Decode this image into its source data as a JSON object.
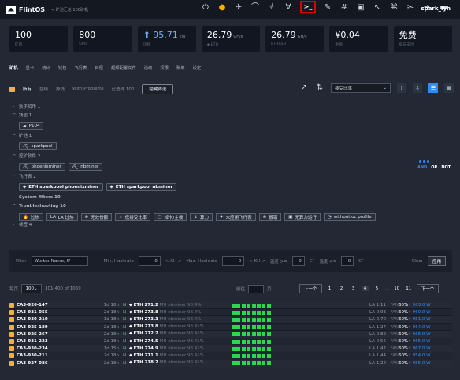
{
  "header": {
    "title": "FlintOS",
    "breadcrumb": "< 矿池汇总 100矿机",
    "user": "spark_lyh",
    "icons": [
      "power-icon",
      "warning-icon",
      "flash-icon",
      "graph-icon",
      "pipeline-icon",
      "filter-icon",
      "terminal-icon",
      "brush-icon",
      "hash-icon",
      "display-icon",
      "wrench-icon",
      "calculator-icon",
      "tool-icon",
      "send-icon",
      "menu-icon"
    ]
  },
  "stats": [
    {
      "value": "100",
      "unit": "",
      "label": "矿机"
    },
    {
      "value": "800",
      "unit": "",
      "label": "GPU"
    },
    {
      "value": "⬆ 95.71",
      "unit": "kW",
      "label": "功耗"
    },
    {
      "value": "26.79",
      "unit": "GH/s",
      "label": "⬥ ETH"
    },
    {
      "value": "26.79",
      "unit": "GH/s",
      "label": "ETHASH"
    },
    {
      "value": "¥0.04",
      "unit": "",
      "label": "余额"
    },
    {
      "value": "免费",
      "unit": "",
      "label": "每日支出"
    }
  ],
  "tabs": [
    "矿机",
    "显卡",
    "统计",
    "钱包",
    "飞行表",
    "日程",
    "超频配置文件",
    "活动",
    "权限",
    "账单",
    "设定"
  ],
  "filters": {
    "all": "所有",
    "online": "在线",
    "offline": "掉线",
    "problems": "With Problems",
    "selected": "已选择 100",
    "hide_button": "隐藏筛选",
    "sort": "接受比率"
  },
  "tree": {
    "digital": "数字货币 1",
    "wallet": "钱包 1",
    "wallet_chip": "P104",
    "pool": "矿池 1",
    "pool_chip": "sparkpool",
    "software": "挖矿软件 2",
    "software_chips": [
      "phoenixminer",
      "nbminer"
    ],
    "flight": "飞行表 2",
    "flight_chips": [
      "ETH sparkpool phoenixminer",
      "ETH sparkpool nbminer"
    ],
    "system": "System filters 10",
    "troubleshooting": "Troubleshooting 10",
    "trouble_chips": [
      "过热",
      "LA 过热",
      "无效份额",
      "低接受比率",
      "掉卡/主板",
      "算力",
      "未应用飞行表",
      "报错",
      "无算力运行",
      "without oc profile"
    ],
    "tags": "标签 4",
    "legend": [
      "AND",
      "OR",
      "NOT"
    ]
  },
  "filterbar": {
    "filter_label": "Filter",
    "name_placeholder": "Worker Name, IP",
    "min_label": "Min. Hashrate",
    "min_value": "0",
    "khs": "< KH >",
    "max_label": "Max. Hashrate",
    "max_value": "0",
    "temp_label": "温度 >=",
    "temp_value": "0",
    "temp2_label": "温度 <=",
    "temp2_value": "0",
    "unit": "C°",
    "clear": "Clear",
    "apply": "应用"
  },
  "pagination": {
    "per_page_label": "每页",
    "per_page": "100",
    "range": "301-400 of 1059",
    "jump_label": "前往",
    "page_label": "页",
    "prev": "上一个",
    "pages": [
      "1",
      "2",
      "3",
      "4",
      "5"
    ],
    "dots": "...",
    "end_pages": [
      "10",
      "11"
    ],
    "next": "下一个"
  },
  "rows": [
    {
      "name": "CA3-926-147",
      "time": "1d 18h",
      "status": "N",
      "coin": "ETH",
      "hash": "271.2",
      "unit": "MH",
      "pool": "nbminer 98.4%",
      "la": "LA 1.11",
      "fan": "FAN",
      "pct": "60%",
      "power": "⚡ 963.0 W"
    },
    {
      "name": "CA3-931-055",
      "time": "2d 18h",
      "status": "N",
      "coin": "ETH",
      "hash": "273.8",
      "unit": "MH",
      "pool": "nbminer 98.4%",
      "la": "LA 0.93",
      "fan": "FAN",
      "pct": "60%",
      "power": "⚡ 960.0 W"
    },
    {
      "name": "CA3-930-210",
      "time": "1d 18h",
      "status": "N",
      "coin": "ETH",
      "hash": "273.3",
      "unit": "MH",
      "pool": "nbminer 98.4%",
      "la": "LA 0.70",
      "fan": "FAN",
      "pct": "60%",
      "power": "⚡ 951.0 W"
    },
    {
      "name": "CA3-925-189",
      "time": "2d 18h",
      "status": "N",
      "coin": "ETH",
      "hash": "273.8",
      "unit": "MH",
      "pool": "nbminer 98.41%",
      "la": "LA 1.27",
      "fan": "FAN",
      "pct": "60%",
      "power": "⚡ 964.0 W"
    },
    {
      "name": "CA3-925-267",
      "time": "2d 18h",
      "status": "N",
      "coin": "ETH",
      "hash": "272.2",
      "unit": "MH",
      "pool": "nbminer 98.41%",
      "la": "LA 0.89",
      "fan": "FAN",
      "pct": "60%",
      "power": "⚡ 966.0 W"
    },
    {
      "name": "CA3-931-223",
      "time": "2d 18h",
      "status": "N",
      "coin": "ETH",
      "hash": "274.5",
      "unit": "MH",
      "pool": "nbminer 98.41%",
      "la": "LA 0.56",
      "fan": "FAN",
      "pct": "60%",
      "power": "⚡ 965.0 W"
    },
    {
      "name": "CA3-930-234",
      "time": "1d 15h",
      "status": "N",
      "coin": "ETH",
      "hash": "274.9",
      "unit": "MH",
      "pool": "nbminer 98.41%",
      "la": "LA 1.47",
      "fan": "FAN",
      "pct": "60%",
      "power": "⚡ 967.0 W"
    },
    {
      "name": "CA3-930-211",
      "time": "2d 18h",
      "status": "N",
      "coin": "ETH",
      "hash": "271.1",
      "unit": "MH",
      "pool": "nbminer 98.41%",
      "la": "LA 1.44",
      "fan": "FAN",
      "pct": "60%",
      "power": "⚡ 954.0 W"
    },
    {
      "name": "CA3-927-086",
      "time": "2d 18h",
      "status": "N",
      "coin": "ETH",
      "hash": "218.2",
      "unit": "MH",
      "pool": "nbminer 98.41%",
      "la": "LA 1.22",
      "fan": "FAN",
      "pct": "60%",
      "power": "⚡ 955.0 W"
    }
  ]
}
